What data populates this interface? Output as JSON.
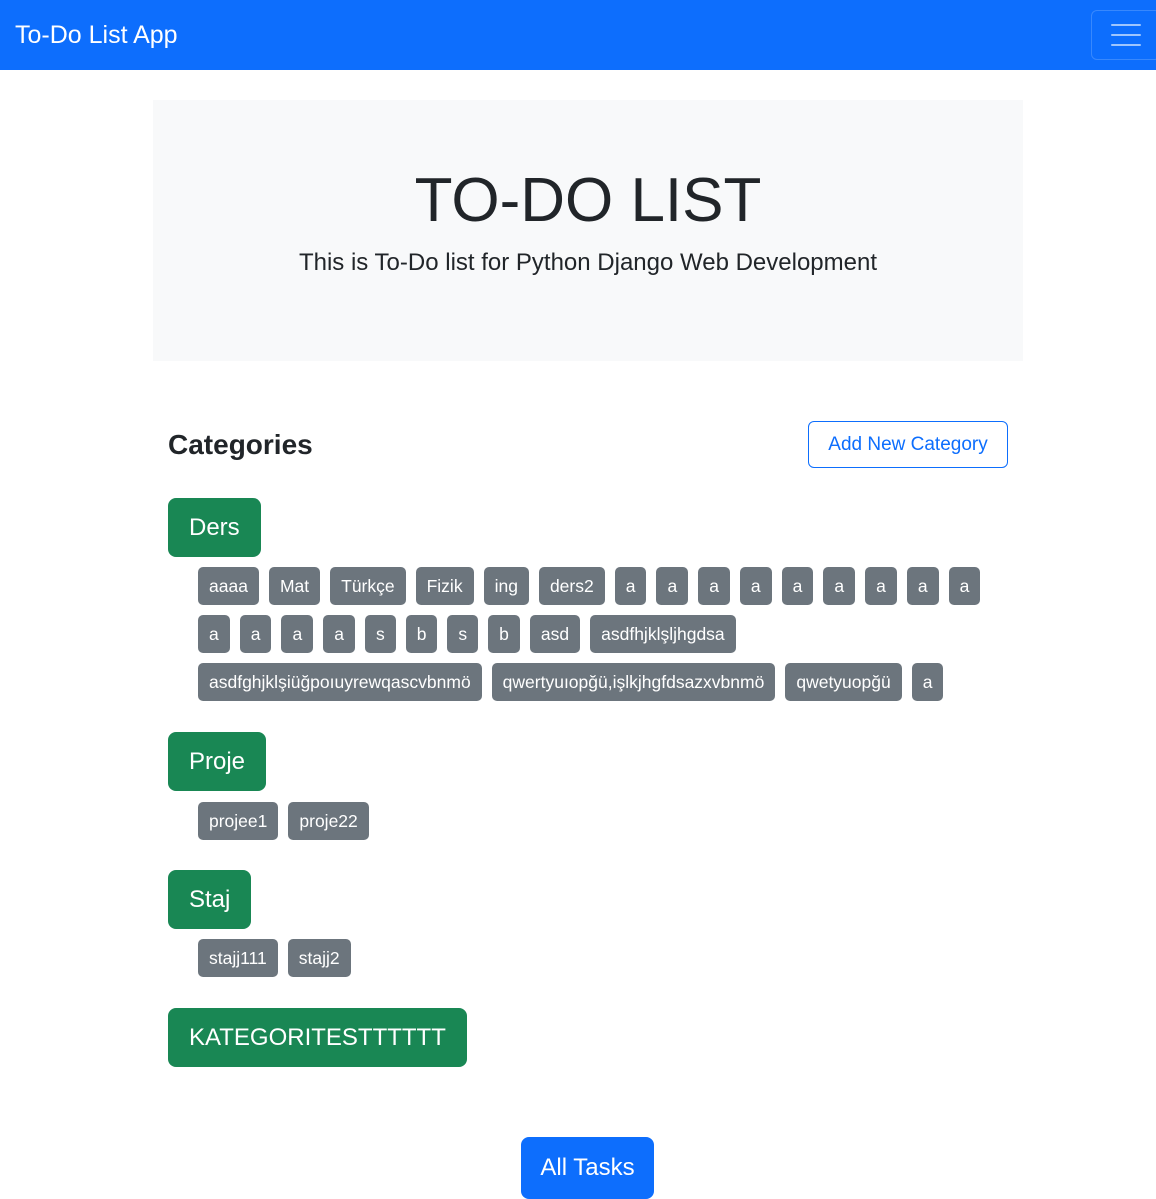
{
  "navbar": {
    "brand": "To-Do List App",
    "toggler_icon": "hamburger-menu-icon"
  },
  "hero": {
    "title": "TO-DO LIST",
    "subtitle": "This is To-Do list for Python Django Web Development"
  },
  "categories_section": {
    "heading": "Categories",
    "add_button_label": "Add New Category"
  },
  "categories": [
    {
      "name": "Ders",
      "tasks": [
        "aaaa",
        "Mat",
        "Türkçe",
        "Fizik",
        "ing",
        "ders2",
        "a",
        "a",
        "a",
        "a",
        "a",
        "a",
        "a",
        "a",
        "a",
        "a",
        "a",
        "a",
        "a",
        "s",
        "b",
        "s",
        "b",
        "asd",
        "asdfhjklşljhgdsa",
        "asdfghjklşiüğpoıuyrewqascvbnmö",
        "qwertyuıopğü,işlkjhgfdsazxvbnmö",
        "qwetyuopğü",
        "a"
      ]
    },
    {
      "name": "Proje",
      "tasks": [
        "projee1",
        "proje22"
      ]
    },
    {
      "name": "Staj",
      "tasks": [
        "stajj111",
        "stajj2"
      ]
    },
    {
      "name": "KATEGORITESTTTTTT",
      "tasks": []
    }
  ],
  "footer": {
    "all_tasks_label": "All Tasks"
  },
  "colors": {
    "primary": "#0d6efd",
    "success": "#198754",
    "secondary": "#6c757d",
    "hero_bg": "#f8f9fa"
  }
}
